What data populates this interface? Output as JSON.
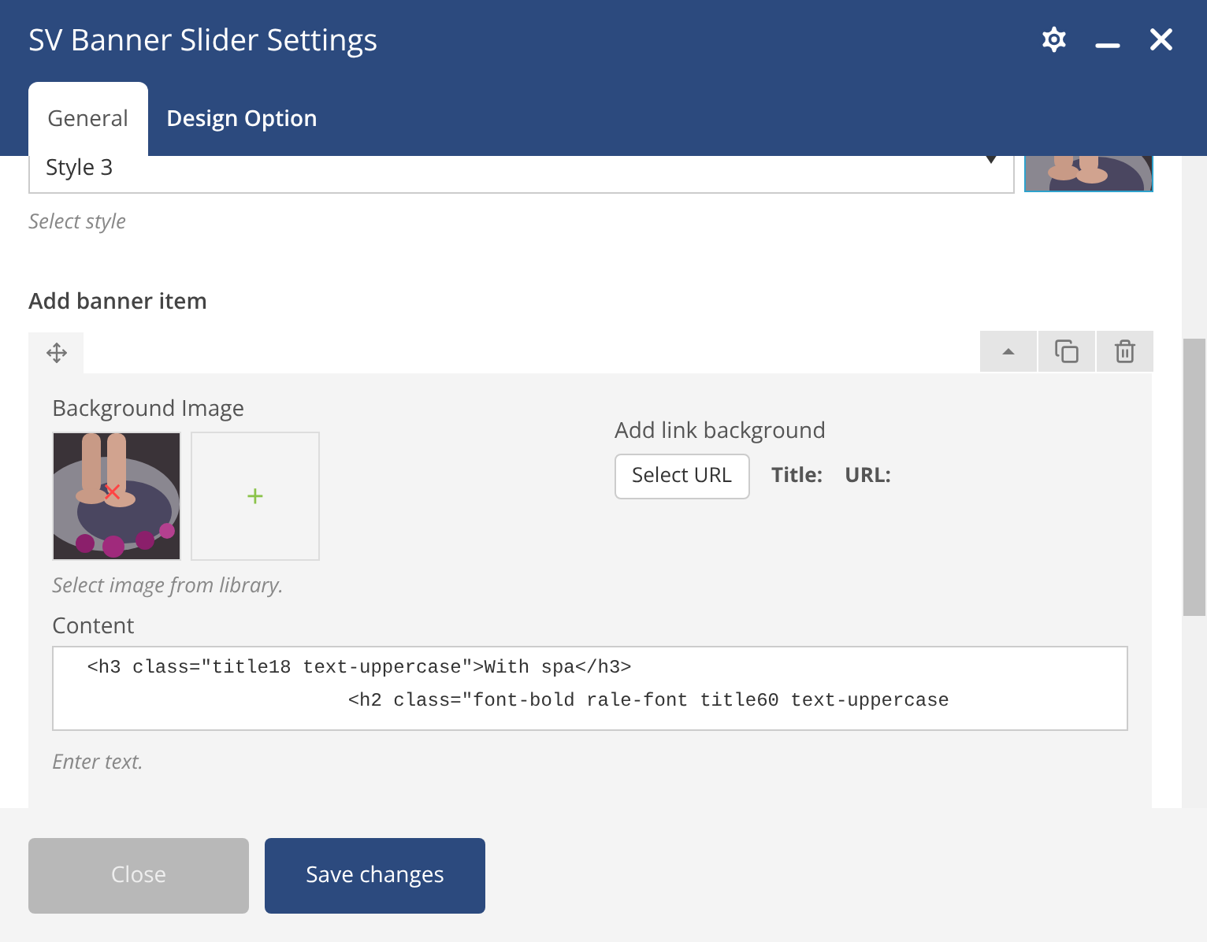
{
  "window": {
    "title": "SV Banner Slider Settings"
  },
  "tabs": [
    {
      "label": "General",
      "selected": true
    },
    {
      "label": "Design Option",
      "selected": false
    }
  ],
  "style_select": {
    "value": "Style 3",
    "hint": "Select style"
  },
  "banner": {
    "heading": "Add banner item",
    "background_image": {
      "label": "Background Image",
      "add": "+",
      "remove": "×",
      "hint": "Select image from library."
    },
    "link": {
      "label": "Add link background",
      "button": "Select URL",
      "title_label": "Title:",
      "url_label": "URL:"
    },
    "content": {
      "label": "Content",
      "value": " <h3 class=\"title18 text-uppercase\">With spa</h3>\n                        <h2 class=\"font-bold rale-font title60 text-uppercase",
      "hint": "Enter text."
    }
  },
  "buttons": [
    {
      "label": "Close",
      "kind": "secondary"
    },
    {
      "label": "Save changes",
      "kind": "primary"
    }
  ]
}
